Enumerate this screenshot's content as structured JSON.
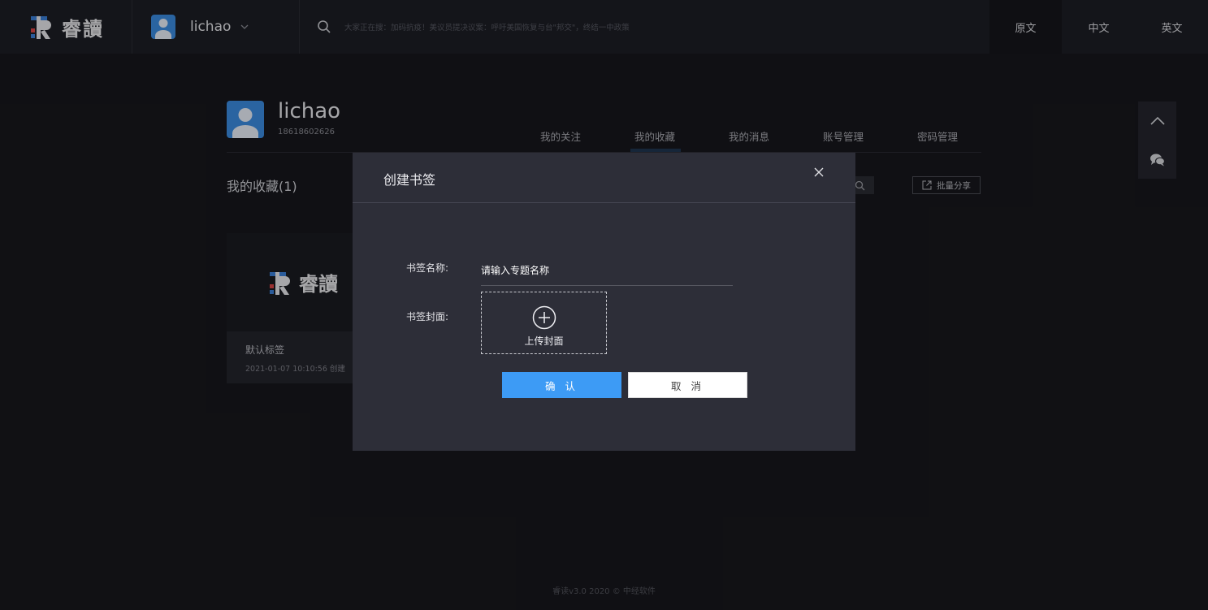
{
  "brand": {
    "logo_text": "睿讀"
  },
  "header": {
    "user_name": "lichao",
    "search_placeholder": "大家正在搜：加码抗疫！美议员提决议案：呼吁美国恢复与台\"邦交\"，终结一中政策",
    "languages": [
      "原文",
      "中文",
      "英文"
    ],
    "active_language": "原文"
  },
  "profile": {
    "name": "lichao",
    "phone": "18618602626",
    "tabs": [
      "我的关注",
      "我的收藏",
      "我的消息",
      "账号管理",
      "密码管理"
    ],
    "active_tab": "我的收藏"
  },
  "favorites": {
    "title": "我的收藏(1)",
    "share_label": "批量分享",
    "cards": [
      {
        "label": "默认标签",
        "date": "2021-01-07 10:10:56 创建"
      }
    ]
  },
  "modal": {
    "title": "创建书签",
    "name_label": "书签名称:",
    "name_placeholder": "请输入专题名称",
    "cover_label": "书签封面:",
    "upload_label": "上传封面",
    "confirm_label": "确 认",
    "cancel_label": "取 消"
  },
  "footer": {
    "text": "睿读v3.0 2020 © 中经软件"
  },
  "colors": {
    "page_bg": "#17171c",
    "header_bg": "#1d1e25",
    "modal_bg": "#2d2e38",
    "primary": "#3d9bf5",
    "avatar": "#3b8be0",
    "logo_blue": "#3b7fd6",
    "logo_red": "#d64545"
  },
  "icons": [
    "search-icon",
    "chevron-down-icon",
    "close-icon",
    "plus-circle-icon",
    "share-icon",
    "chevron-up-icon",
    "chat-icon"
  ]
}
